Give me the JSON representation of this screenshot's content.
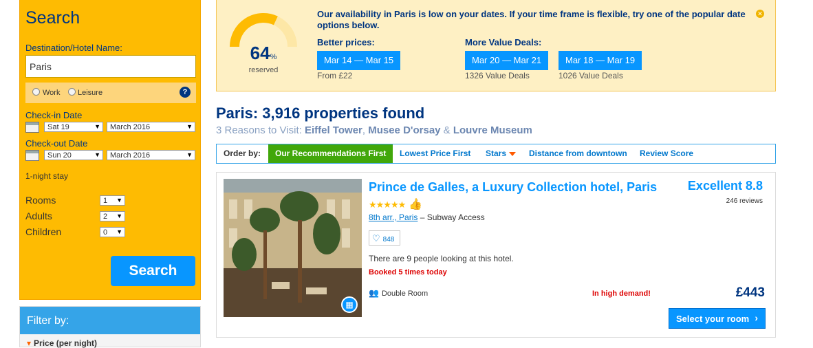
{
  "search": {
    "title": "Search",
    "destination_label": "Destination/Hotel Name:",
    "destination_value": "Paris",
    "purpose_work": "Work",
    "purpose_leisure": "Leisure",
    "help_symbol": "?",
    "checkin_label": "Check-in Date",
    "checkin_day": "Sat 19",
    "checkin_month": "March 2016",
    "checkout_label": "Check-out Date",
    "checkout_day": "Sun 20",
    "checkout_month": "March 2016",
    "stay_text": "1-night stay",
    "rooms_label": "Rooms",
    "rooms_value": "1",
    "adults_label": "Adults",
    "adults_value": "2",
    "children_label": "Children",
    "children_value": "0",
    "button_label": "Search"
  },
  "filter": {
    "title": "Filter by:",
    "first_item": "Price (per night)"
  },
  "banner": {
    "gauge_value": "64",
    "gauge_unit": "%",
    "gauge_level": 0.64,
    "gauge_label": "reserved",
    "message": "Our availability in Paris is low on your dates. If your time frame is flexible, try one of the popular date options below.",
    "better_label": "Better prices:",
    "better_dates": "Mar 14 — Mar 15",
    "better_sub": "From £22",
    "value_label": "More Value Deals:",
    "value_deals": [
      {
        "dates": "Mar 20 — Mar 21",
        "sub": "1326 Value Deals"
      },
      {
        "dates": "Mar 18 — Mar 19",
        "sub": "1026 Value Deals"
      }
    ]
  },
  "results": {
    "title": "Paris: 3,916 properties found",
    "reasons_prefix": "3 Reasons to Visit:",
    "reason1": "Eiffel Tower",
    "reason2": "Musee D'orsay",
    "reason3": "Louvre Museum",
    "sep_comma": ",",
    "sep_amp": "&"
  },
  "sort": {
    "label": "Order by:",
    "active": "Our Recommendations First",
    "options": [
      "Lowest Price First",
      "Stars",
      "Distance from downtown",
      "Review Score"
    ]
  },
  "hotel": {
    "name": "Prince de Galles, a Luxury Collection hotel, Paris",
    "stars": "★★★★★",
    "star_count": 5,
    "district": "8th arr., Paris",
    "transit": "– Subway Access",
    "favorites": "848",
    "looking": "There are 9 people looking at this hotel.",
    "booked": "Booked 5 times today",
    "room": "Double Room",
    "demand": "In high demand!",
    "score": "Excellent 8.8",
    "reviews": "246 reviews",
    "price": "£443",
    "select_label": "Select your room"
  },
  "colors": {
    "brand_blue": "#003580",
    "action_blue": "#0896ff",
    "yellow": "#febb02",
    "green": "#41a70a",
    "alert_red": "#dd0000"
  }
}
